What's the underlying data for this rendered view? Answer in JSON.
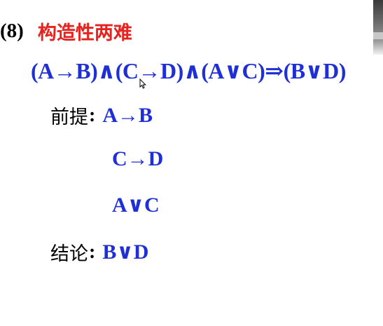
{
  "slide": {
    "number": "(8)",
    "title": "构造性两难",
    "formula": "(A→B)∧(C→D)∧(A∨C)⇒(B∨D)",
    "premise_label": "前提",
    "premises": [
      "A→B",
      "C→D",
      "A∨C"
    ],
    "conclusion_label": "结论",
    "conclusion": "B∨D",
    "colon": ":"
  },
  "colors": {
    "title": "#e6231f",
    "formula": "#1f2fd6",
    "text": "#000000"
  },
  "icons": {
    "cursor": "mouse-pointer-icon"
  }
}
